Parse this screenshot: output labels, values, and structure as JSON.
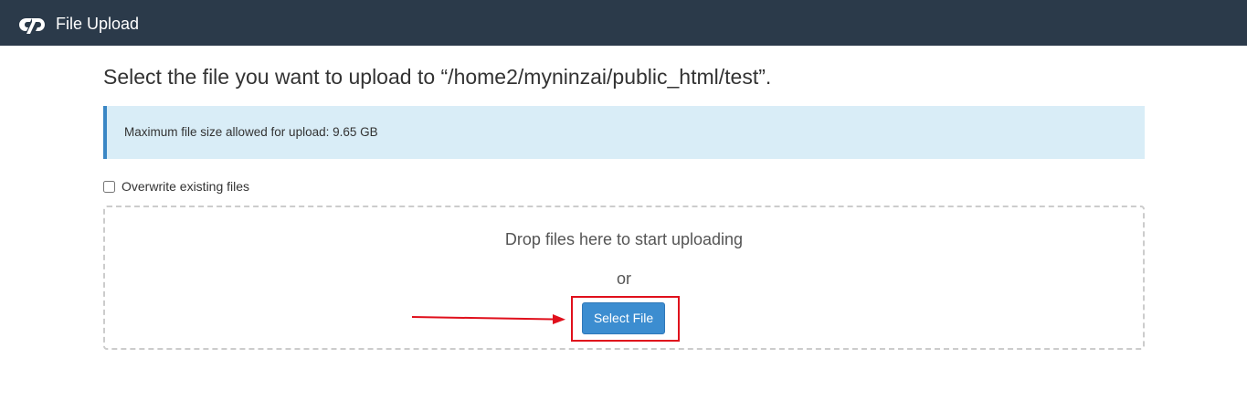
{
  "header": {
    "logo_icon": "cpanel-logo-icon",
    "title": "File Upload",
    "background": "#2b3a4a"
  },
  "main": {
    "heading": "Select the file you want to upload to “/home2/myninzai/public_html/test”.",
    "info": {
      "text": "Maximum file size allowed for upload: 9.65 GB",
      "background": "#d9edf7",
      "accent": "#3a87c5"
    },
    "overwrite": {
      "label": "Overwrite existing files",
      "checked": false
    },
    "dropzone": {
      "prompt": "Drop files here to start uploading",
      "or_text": "or",
      "button_label": "Select File",
      "button_color": "#3c8dd0"
    },
    "annotation": {
      "highlight_color": "#e0101c",
      "arrow_icon": "arrow-right-icon"
    }
  }
}
